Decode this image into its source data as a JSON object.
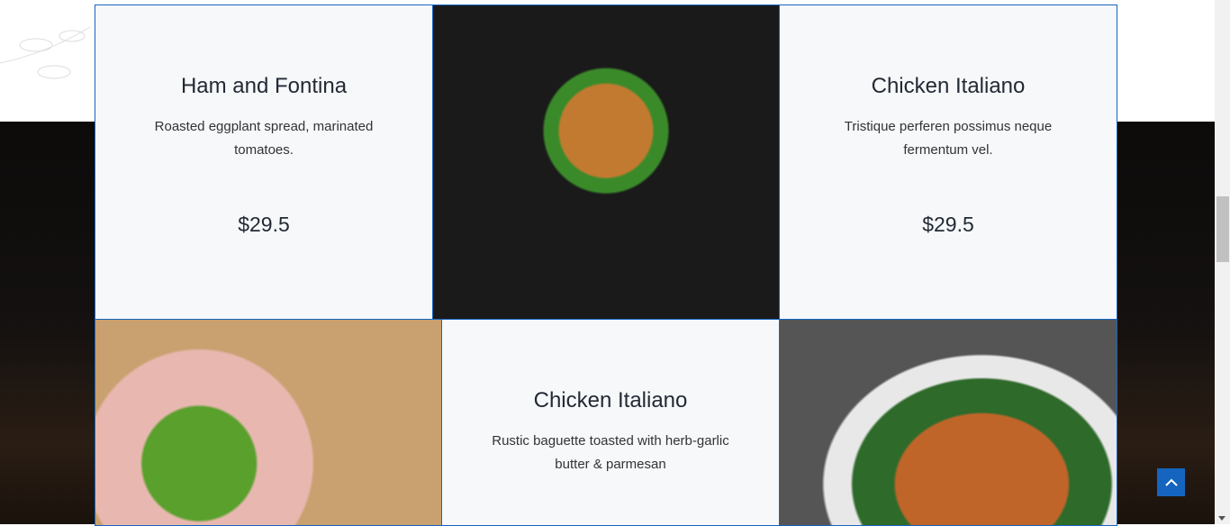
{
  "menu_items": [
    {
      "title": "Ham and Fontina",
      "description": "Roasted eggplant spread, marinated tomatoes.",
      "price": "$29.5"
    },
    {
      "title": "Chicken Italiano",
      "description": "Tristique perferen possimus neque fermentum vel.",
      "price": "$29.5"
    },
    {
      "title": "Chicken Italiano",
      "description": "Rustic baguette toasted with herb-garlic butter & parmesan"
    }
  ],
  "colors": {
    "accent": "#1565c0"
  }
}
